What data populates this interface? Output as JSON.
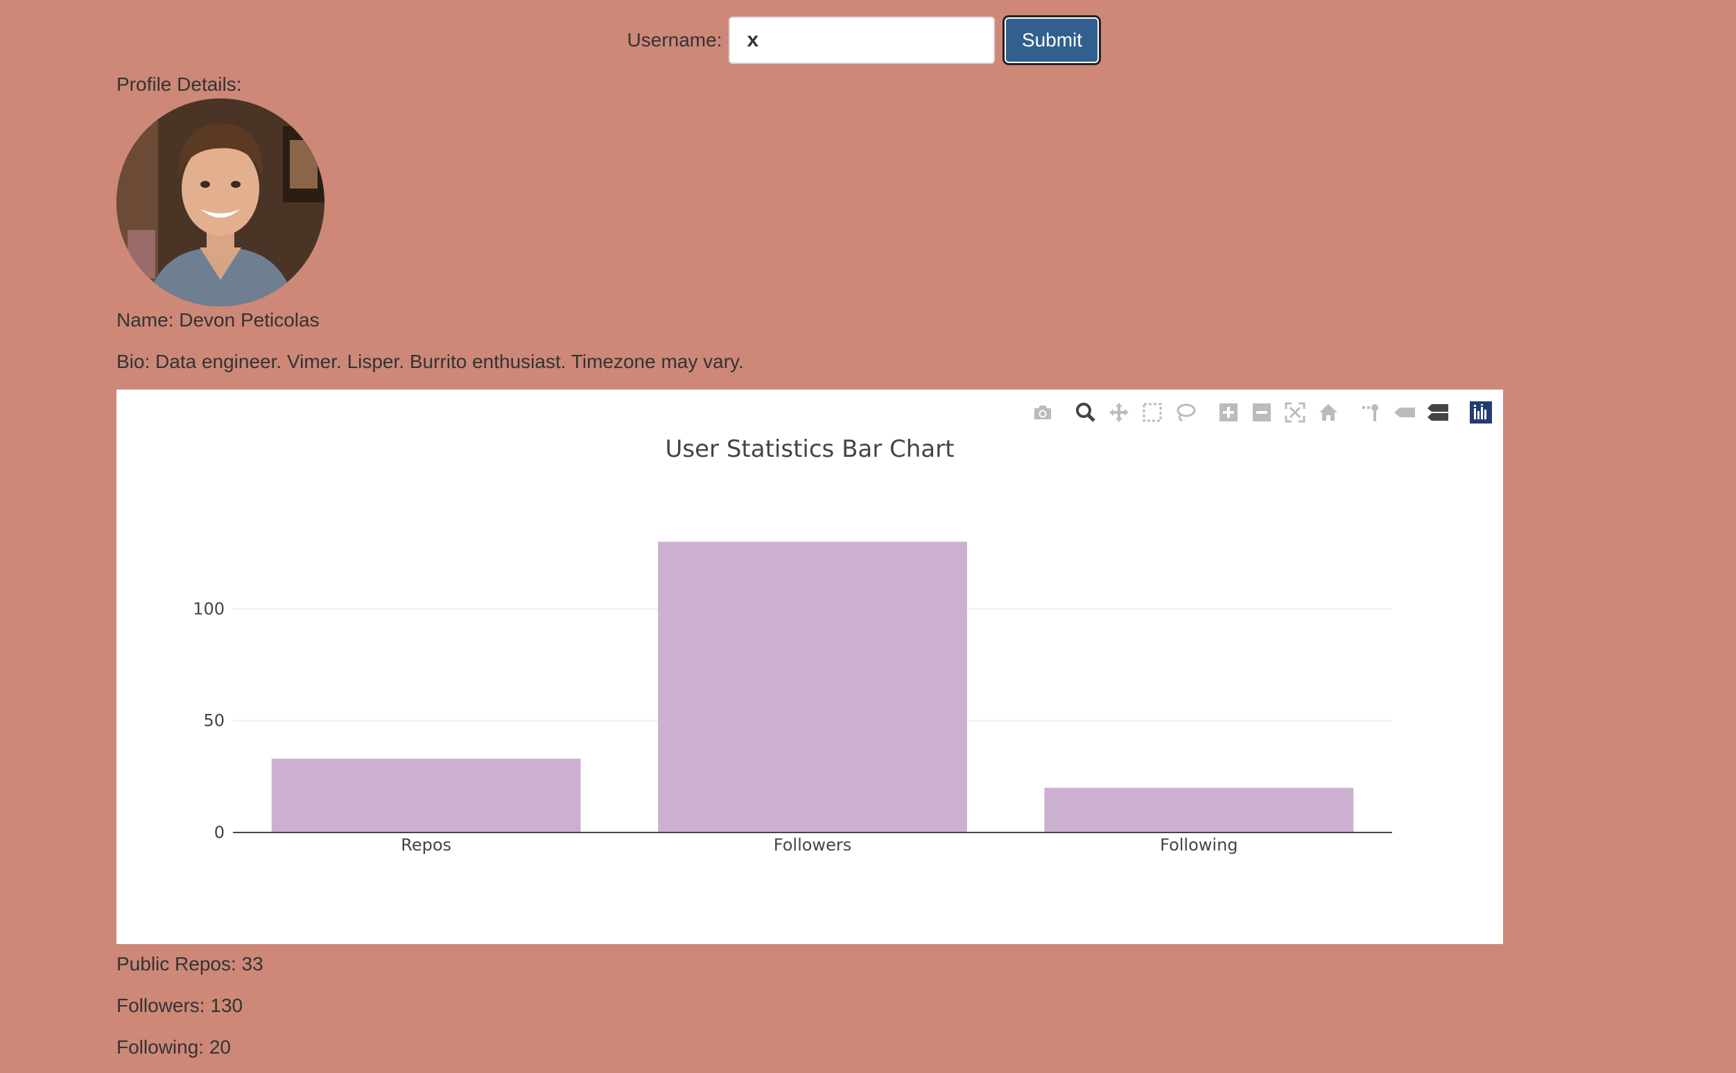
{
  "form": {
    "username_label": "Username:",
    "username_value": "x",
    "submit_label": "Submit"
  },
  "profile": {
    "heading": "Profile Details:",
    "name_line": "Name: Devon Peticolas",
    "bio_line": "Bio: Data engineer. Vimer. Lisper. Burrito enthusiast. Timezone may vary."
  },
  "toolbar": {
    "icons": [
      "camera-icon",
      "zoom-icon",
      "pan-icon",
      "box-select-icon",
      "lasso-select-icon",
      "zoom-in-icon",
      "zoom-out-icon",
      "autoscale-icon",
      "reset-axes-icon",
      "spike-lines-icon",
      "hover-closest-icon",
      "hover-compare-icon",
      "plotly-logo-icon"
    ]
  },
  "chart_data": {
    "type": "bar",
    "title": "User Statistics Bar Chart",
    "categories": [
      "Repos",
      "Followers",
      "Following"
    ],
    "values": [
      33,
      130,
      20
    ],
    "yticks": [
      0,
      50,
      100
    ],
    "ylim": [
      0,
      137
    ],
    "grid": true,
    "bar_color": "#cbb1cf"
  },
  "stats": {
    "repos_line": "Public Repos: 33",
    "followers_line": "Followers: 130",
    "following_line": "Following: 20"
  },
  "colors": {
    "background": "#cd8878",
    "button": "#31608f",
    "bar": "#cbb1cf"
  }
}
